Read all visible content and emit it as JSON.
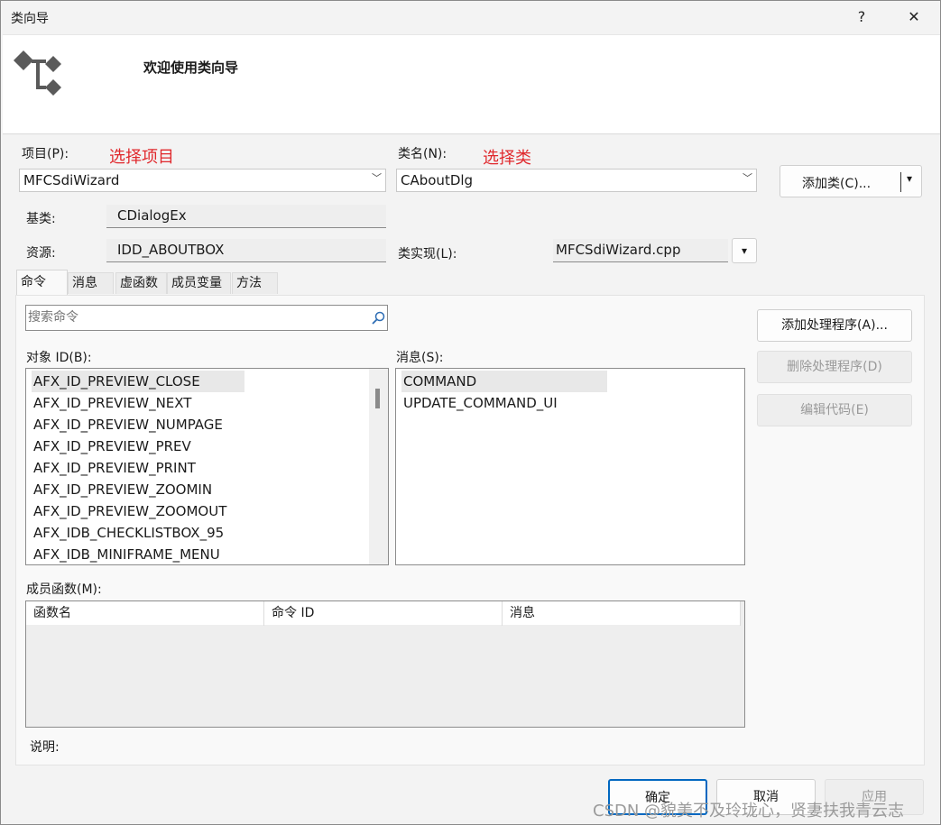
{
  "window": {
    "title": "类向导",
    "help": "?",
    "close": "✕"
  },
  "header": {
    "title": "欢迎使用类向导"
  },
  "project": {
    "label": "项目(P):",
    "value": "MFCSdiWizard",
    "annotation": "选择项目"
  },
  "classname": {
    "label": "类名(N):",
    "value": "CAboutDlg",
    "annotation": "选择类"
  },
  "add_class": {
    "label": "添加类(C)...",
    "arrow": "▾"
  },
  "base_class": {
    "label": "基类:",
    "value": "CDialogEx"
  },
  "resource": {
    "label": "资源:",
    "value": "IDD_ABOUTBOX"
  },
  "class_impl": {
    "label": "类实现(L):",
    "value": "MFCSdiWizard.cpp",
    "arrow": "▾"
  },
  "tabs": [
    {
      "label": "命令",
      "active": true
    },
    {
      "label": "消息"
    },
    {
      "label": "虚函数"
    },
    {
      "label": "成员变量"
    },
    {
      "label": "方法"
    }
  ],
  "search": {
    "placeholder": "搜索命令",
    "icon": "search-icon"
  },
  "object_ids": {
    "label": "对象 ID(B):",
    "items": [
      "AFX_ID_PREVIEW_CLOSE",
      "AFX_ID_PREVIEW_NEXT",
      "AFX_ID_PREVIEW_NUMPAGE",
      "AFX_ID_PREVIEW_PREV",
      "AFX_ID_PREVIEW_PRINT",
      "AFX_ID_PREVIEW_ZOOMIN",
      "AFX_ID_PREVIEW_ZOOMOUT",
      "AFX_IDB_CHECKLISTBOX_95",
      "AFX_IDB_MINIFRAME_MENU"
    ]
  },
  "messages": {
    "label": "消息(S):",
    "items": [
      "COMMAND",
      "UPDATE_COMMAND_UI"
    ]
  },
  "actions": {
    "add_handler": "添加处理程序(A)...",
    "delete_handler": "删除处理程序(D)",
    "edit_code": "编辑代码(E)"
  },
  "member_functions": {
    "label": "成员函数(M):",
    "columns": [
      "函数名",
      "命令 ID",
      "消息"
    ]
  },
  "description": {
    "label": "说明:"
  },
  "footer": {
    "ok": "确定",
    "cancel": "取消",
    "apply": "应用"
  },
  "watermark": "CSDN @貌美不及玲珑心，贤妻扶我青云志",
  "colors": {
    "annotation": "#e0282c",
    "ok_border": "#0067c0"
  }
}
